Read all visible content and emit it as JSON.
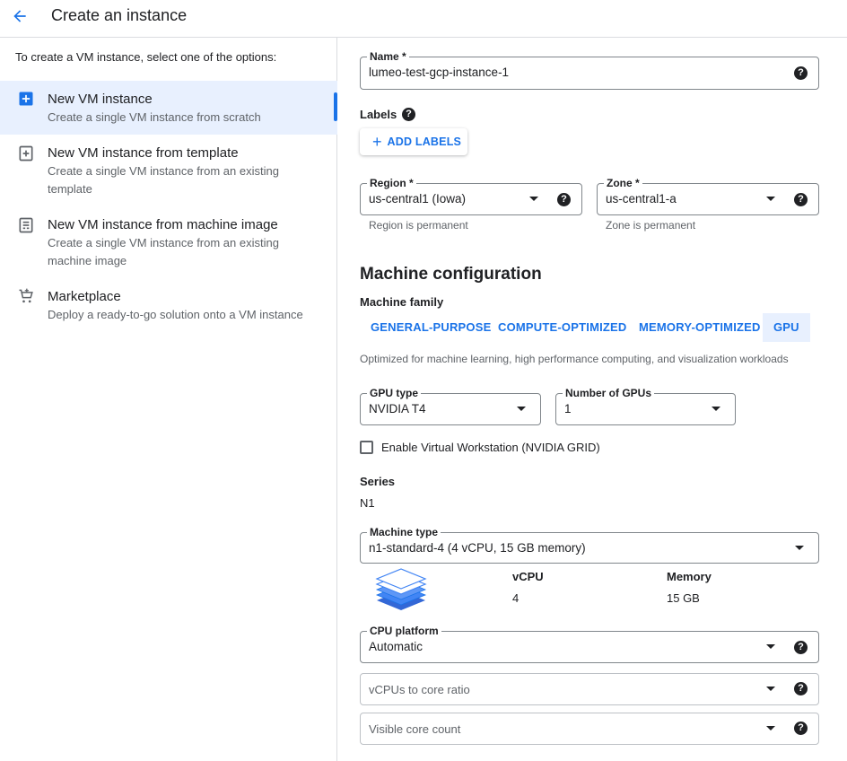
{
  "header": {
    "title": "Create an instance"
  },
  "left": {
    "intro": "To create a VM instance, select one of the options:",
    "options": [
      {
        "title": "New VM instance",
        "desc": "Create a single VM instance from scratch"
      },
      {
        "title": "New VM instance from template",
        "desc": "Create a single VM instance from an existing template"
      },
      {
        "title": "New VM instance from machine image",
        "desc": "Create a single VM instance from an existing machine image"
      },
      {
        "title": "Marketplace",
        "desc": "Deploy a ready-to-go solution onto a VM instance"
      }
    ]
  },
  "form": {
    "name": {
      "label": "Name *",
      "value": "lumeo-test-gcp-instance-1"
    },
    "labels": {
      "title": "Labels",
      "add_button": "ADD LABELS"
    },
    "region": {
      "label": "Region *",
      "value": "us-central1 (Iowa)",
      "hint": "Region is permanent"
    },
    "zone": {
      "label": "Zone *",
      "value": "us-central1-a",
      "hint": "Zone is permanent"
    },
    "machine_config": {
      "title": "Machine configuration",
      "family_label": "Machine family",
      "tabs": [
        "GENERAL-PURPOSE",
        "COMPUTE-OPTIMIZED",
        "MEMORY-OPTIMIZED",
        "GPU"
      ],
      "active_tab": "GPU",
      "tab_desc": "Optimized for machine learning, high performance computing, and visualization workloads",
      "gpu_type": {
        "label": "GPU type",
        "value": "NVIDIA T4"
      },
      "gpu_count": {
        "label": "Number of GPUs",
        "value": "1"
      },
      "virtual_workstation": {
        "label": "Enable Virtual Workstation (NVIDIA GRID)",
        "checked": false
      },
      "series": {
        "label": "Series",
        "value": "N1"
      },
      "machine_type": {
        "label": "Machine type",
        "value": "n1-standard-4 (4 vCPU, 15 GB memory)"
      },
      "specs": {
        "vcpu_label": "vCPU",
        "vcpu_value": "4",
        "memory_label": "Memory",
        "memory_value": "15 GB"
      },
      "cpu_platform": {
        "label": "CPU platform",
        "value": "Automatic"
      },
      "vcpu_ratio": {
        "placeholder": "vCPUs to core ratio"
      },
      "core_count": {
        "placeholder": "Visible core count"
      }
    }
  },
  "colors": {
    "accent": "#1a73e8",
    "selected_bg": "#e8f0fe",
    "border": "#80868b"
  }
}
